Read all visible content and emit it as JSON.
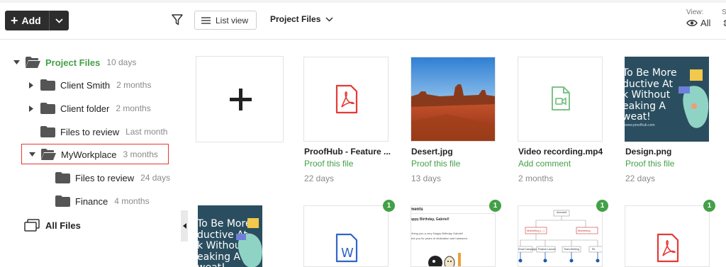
{
  "toolbar": {
    "add_label": "Add",
    "list_view_label": "List view",
    "project_dropdown_label": "Project Files",
    "view_label": "View:",
    "view_value": "All",
    "right_cut_label": "S"
  },
  "tree": {
    "root": {
      "name": "Project Files",
      "time": "10 days"
    },
    "items": [
      {
        "name": "Client Smith",
        "time": "2 months"
      },
      {
        "name": "Client folder",
        "time": "2 months"
      },
      {
        "name": "Files to review",
        "time": "Last month"
      },
      {
        "name": "MyWorkplace",
        "time": "3 months"
      },
      {
        "name": "Files to review",
        "time": "24 days"
      },
      {
        "name": "Finance",
        "time": "4 months"
      }
    ],
    "all_files": "All Files"
  },
  "files": [
    {
      "name": "ProofHub - Feature ...",
      "action": "Proof this file",
      "date": "22 days",
      "icon": "pdf-icon"
    },
    {
      "name": "Desert.jpg",
      "action": "Proof this file",
      "date": "13 days",
      "icon": "image-thumbnail"
    },
    {
      "name": "Video recording.mp4",
      "action": "Add comment",
      "date": "2 months",
      "icon": "video-file-icon"
    },
    {
      "name": "Design.png",
      "action": "Proof this file",
      "date": "22 days",
      "icon": "image-thumbnail"
    }
  ],
  "design_thumb": {
    "lines": [
      "To Be More",
      "ductive At",
      "k Without",
      "eaking A",
      "weat!"
    ],
    "small": "www.proofhub.com"
  },
  "row2": {
    "badges": [
      "1",
      "1",
      "1",
      "1"
    ],
    "comments_thumb": {
      "heading": "ments",
      "line1": "appy Birthday, Gabriel!",
      "line2": "ething you a very Happy Birthday Gabriel!",
      "line3": "ank you for years of dedication and hardwork."
    },
    "chart_thumb": {
      "root": "Account",
      "mid": [
        "Marketing (...)",
        "Marketing"
      ],
      "leaves": [
        "Email Campaign",
        "Feature Launch",
        "Team Meeting",
        "Re"
      ]
    }
  },
  "colors": {
    "accent_green": "#43a047",
    "pdf_red": "#e53935",
    "word_blue": "#2f66c7",
    "design_bg": "#2a4e5f"
  }
}
